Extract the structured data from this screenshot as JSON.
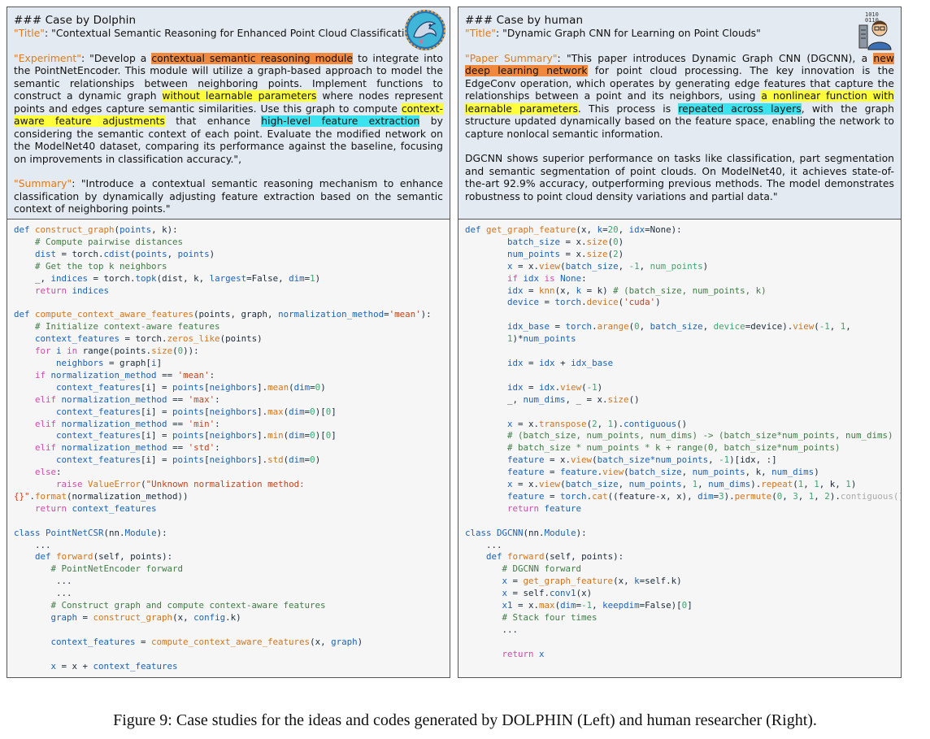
{
  "left": {
    "heading": "### Case by Dolphin",
    "title_key": "\"Title\"",
    "title_rest": ": \"Contextual Semantic Reasoning for Enhanced Point Cloud Classification\"",
    "experiment_key": "\"Experiment\"",
    "summary_key": "\"Summary\"",
    "summary_text": ": \"Introduce a contextual semantic reasoning mechanism to enhance classification by dynamically adjusting feature extraction based on the semantic context of neighboring points.\""
  },
  "right": {
    "heading": "### Case by human",
    "title_key": "\"Title\"",
    "title_rest": ": \"Dynamic Graph CNN for Learning on Point Clouds\"",
    "paper_key": "\"Paper Summary\"",
    "paragraph2": "DGCNN shows superior performance on tasks like classification, part segmentation and semantic segmentation of point clouds. On ModelNet40, it achieves state-of-the-art 92.9% accuracy, outperforming previous methods. The model demonstrates robustness to point cloud density variations and partial data.\""
  },
  "caption": "Figure 9: Case studies for the ideas and codes generated by DOLPHIN (Left) and human researcher (Right).",
  "colors": {
    "idea_background": "#e4eaf1",
    "code_background": "#f6f6f6",
    "key_orange": "#e07b16",
    "highlight_orange": "#f0883e",
    "highlight_yellow": "#ffff3c",
    "highlight_cyan": "#3ce3ee"
  },
  "icons": {
    "left": "dolphin-logo-icon",
    "right": "human-researcher-icon"
  }
}
